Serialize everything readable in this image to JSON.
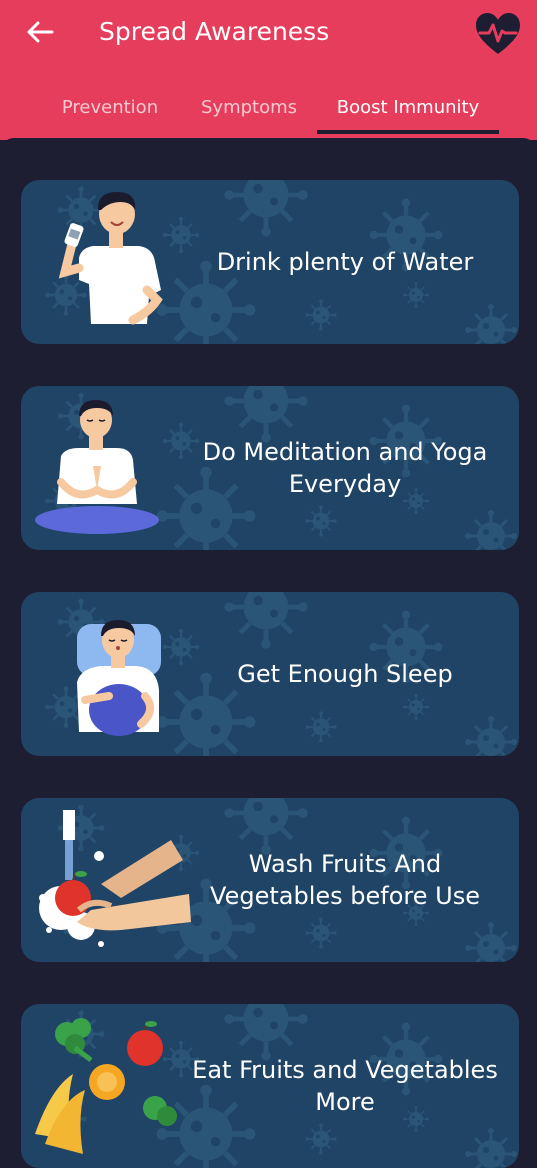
{
  "app_bar": {
    "title": "Spread Awareness",
    "back_icon": "arrow-left-icon",
    "action_icon": "heart-pulse-icon",
    "background_color": "#e63d5c"
  },
  "tabs": [
    {
      "label": "Prevention",
      "active": false
    },
    {
      "label": "Symptoms",
      "active": false
    },
    {
      "label": "Boost Immunity",
      "active": true
    }
  ],
  "cards": [
    {
      "label": "Drink plenty of Water",
      "illustration": "man-drinking-water"
    },
    {
      "label": "Do Meditation and Yoga Everyday",
      "illustration": "man-meditating"
    },
    {
      "label": "Get Enough Sleep",
      "illustration": "man-sleeping-on-pillow"
    },
    {
      "label": "Wash Fruits And Vegetables before Use",
      "illustration": "hands-washing-apple"
    },
    {
      "label": "Eat Fruits and Vegetables More",
      "illustration": "fruits-and-vegetables"
    }
  ],
  "colors": {
    "card_background": "#1f4466",
    "page_background": "#1e1e32",
    "virus_pattern": "#2c5678"
  }
}
